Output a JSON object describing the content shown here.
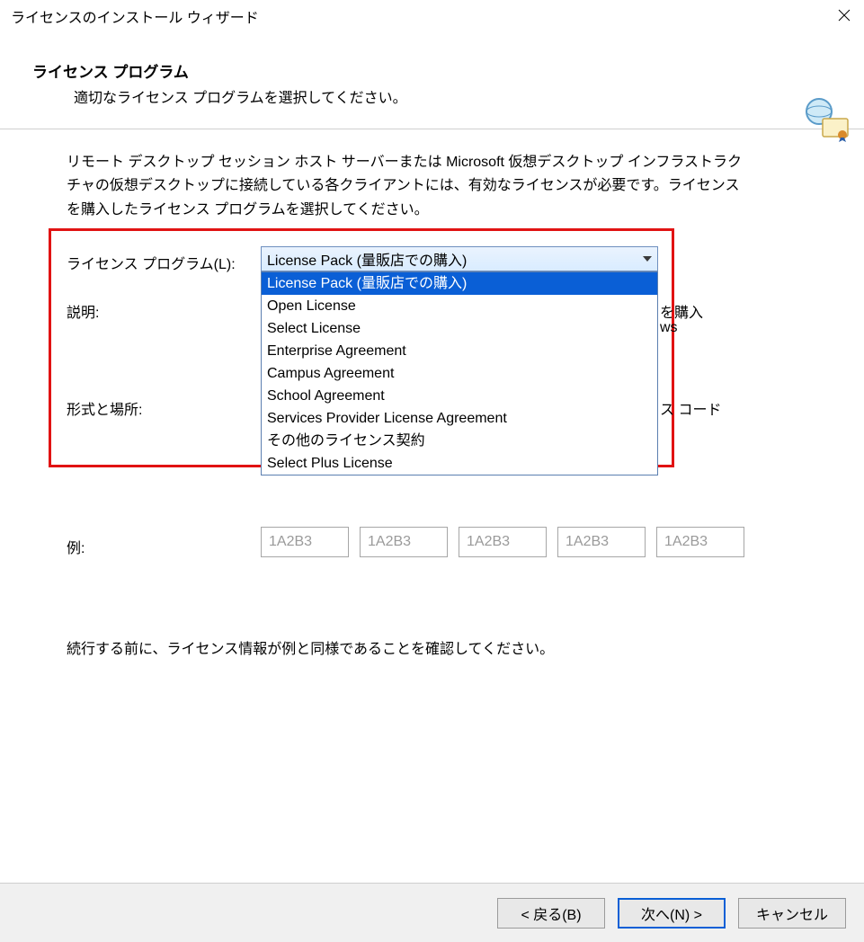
{
  "window": {
    "title": "ライセンスのインストール ウィザード"
  },
  "header": {
    "title": "ライセンス プログラム",
    "subtitle": "適切なライセンス プログラムを選択してください。"
  },
  "intro": "リモート デスクトップ セッション ホスト サーバーまたは Microsoft 仮想デスクトップ インフラストラクチャの仮想デスクトップに接続している各クライアントには、有効なライセンスが必要です。ライセンスを購入したライセンス プログラムを選択してください。",
  "labels": {
    "program": "ライセンス プログラム(L):",
    "description": "説明:",
    "format": "形式と場所:",
    "example": "例:"
  },
  "combo": {
    "selected": "License Pack (量販店での購入)",
    "options": [
      "License Pack (量販店での購入)",
      "Open License",
      "Select License",
      "Enterprise Agreement",
      "Campus Agreement",
      "School Agreement",
      "Services Provider License Agreement",
      "その他のライセンス契約",
      "Select Plus License"
    ]
  },
  "behind": {
    "line1": "を購入",
    "line2": "ws",
    "line3": "ス コード"
  },
  "example_values": [
    "1A2B3",
    "1A2B3",
    "1A2B3",
    "1A2B3",
    "1A2B3"
  ],
  "confirm": "続行する前に、ライセンス情報が例と同様であることを確認してください。",
  "buttons": {
    "back": "< 戻る(B)",
    "next": "次へ(N) >",
    "cancel": "キャンセル"
  }
}
